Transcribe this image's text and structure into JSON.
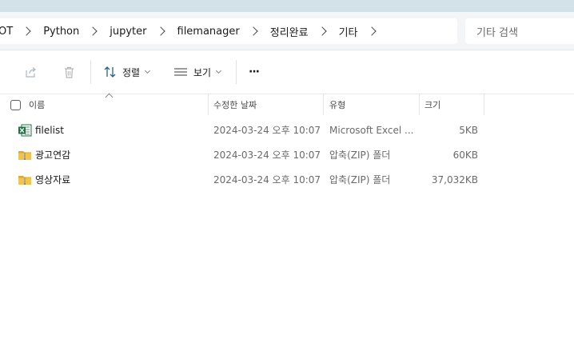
{
  "address": {
    "crumbs": [
      "OT",
      "Python",
      "jupyter",
      "filemanager",
      "정리완료",
      "기타"
    ],
    "search_placeholder": "기타 검색"
  },
  "toolbar": {
    "sort_label": "정렬",
    "view_label": "보기",
    "more_label": "···"
  },
  "columns": {
    "name": "이름",
    "modified": "수정한 날짜",
    "type": "유형",
    "size": "크기"
  },
  "files": [
    {
      "name": "filelist",
      "modified": "2024-03-24 오후 10:07",
      "type": "Microsoft Excel ...",
      "size": "5KB",
      "icon": "excel-file-icon"
    },
    {
      "name": "광고연감",
      "modified": "2024-03-24 오후 10:07",
      "type": "압축(ZIP) 폴더",
      "size": "60KB",
      "icon": "zip-folder-icon"
    },
    {
      "name": "영상자료",
      "modified": "2024-03-24 오후 10:07",
      "type": "압축(ZIP) 폴더",
      "size": "37,032KB",
      "icon": "zip-folder-icon"
    }
  ],
  "colors": {
    "topstrip": "#d3e1e8",
    "excel_green": "#1e7145",
    "folder_yellow": "#f4c542"
  }
}
